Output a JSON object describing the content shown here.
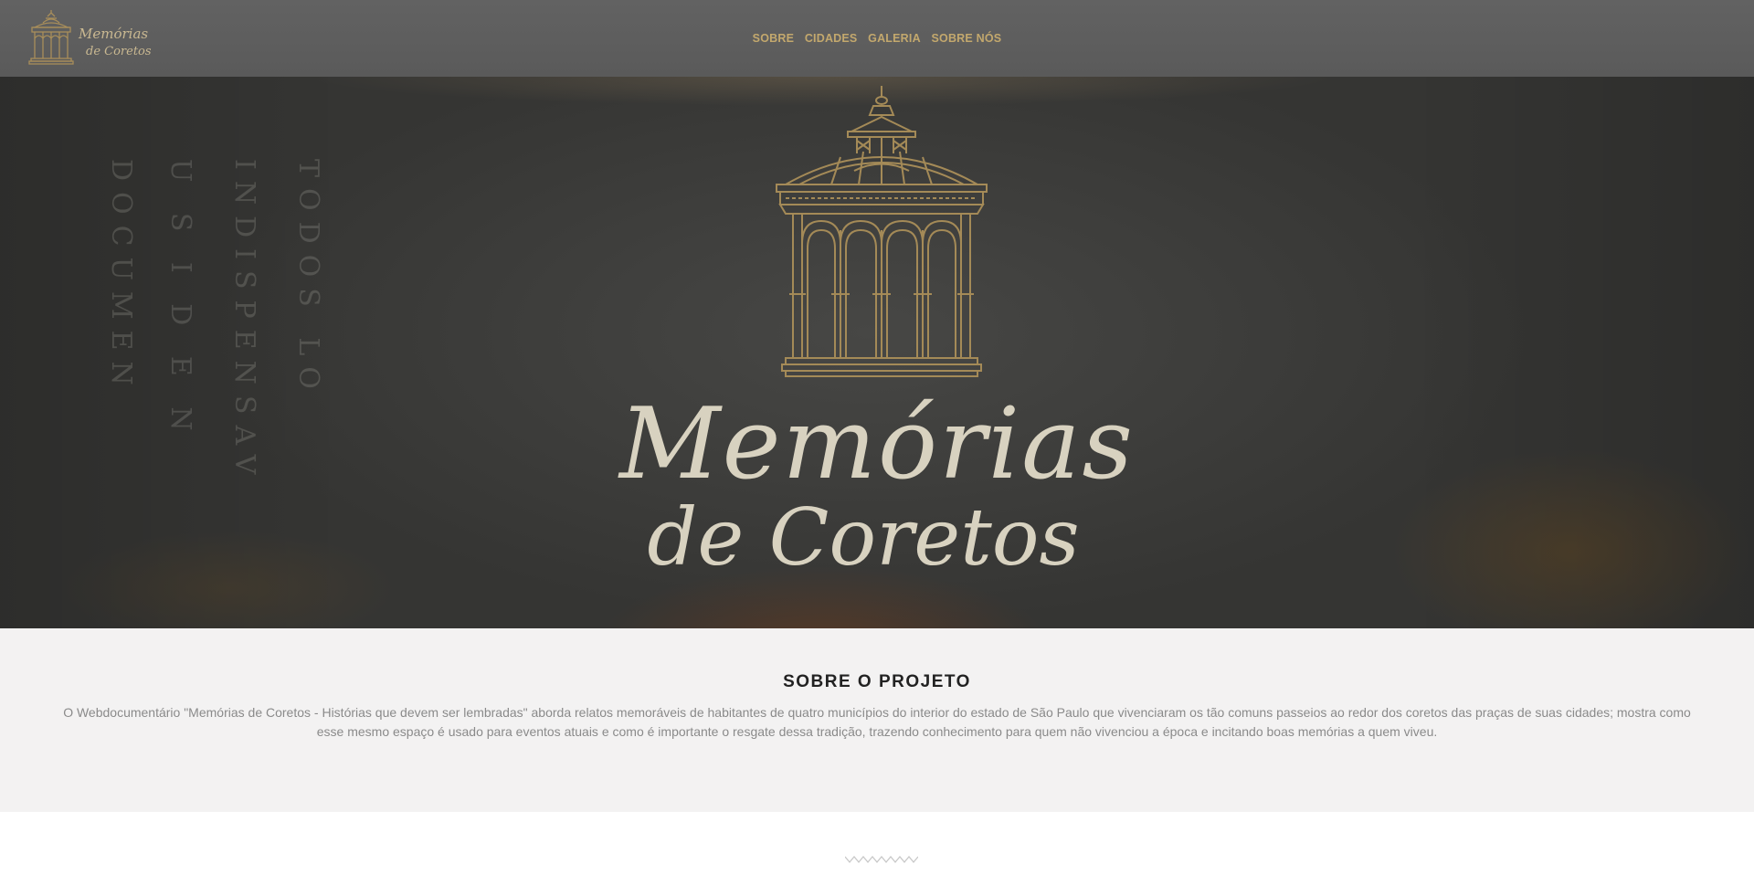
{
  "brand": {
    "logo_text_line1": "Memórias",
    "logo_text_line2": "de Coretos"
  },
  "nav": {
    "items": [
      {
        "label": "SOBRE"
      },
      {
        "label": "CIDADES"
      },
      {
        "label": "GALERIA"
      },
      {
        "label": "SOBRE NÓS"
      }
    ]
  },
  "hero": {
    "title_line1": "Memórias",
    "title_line2": "de Coretos",
    "background_stamps": [
      "DOCUMEN",
      "U S I D E N",
      "INDISPENSAV",
      "TODOS LO"
    ]
  },
  "sobre": {
    "heading": "SOBRE O PROJETO",
    "text": "O Webdocumentário \"Memórias de Coretos - Histórias que devem ser lembradas\" aborda relatos memoráveis de habitantes de quatro municípios do interior do estado de São Paulo que vivenciaram os tão comuns passeios ao redor dos coretos das praças de suas cidades; mostra como esse mesmo espaço é usado para eventos atuais e como é importante o resgate dessa tradição, trazendo conhecimento para quem não vivenciou a época e incitando boas memórias a quem viveu."
  },
  "colors": {
    "header_bg": "#5d5d5d",
    "accent_gold": "#c3a86d",
    "hero_bg": "#3a3a38",
    "section_bg": "#f3f2f2"
  },
  "icons": {
    "logo": "gazebo-logo-icon",
    "divider": "zigzag-divider-icon"
  }
}
